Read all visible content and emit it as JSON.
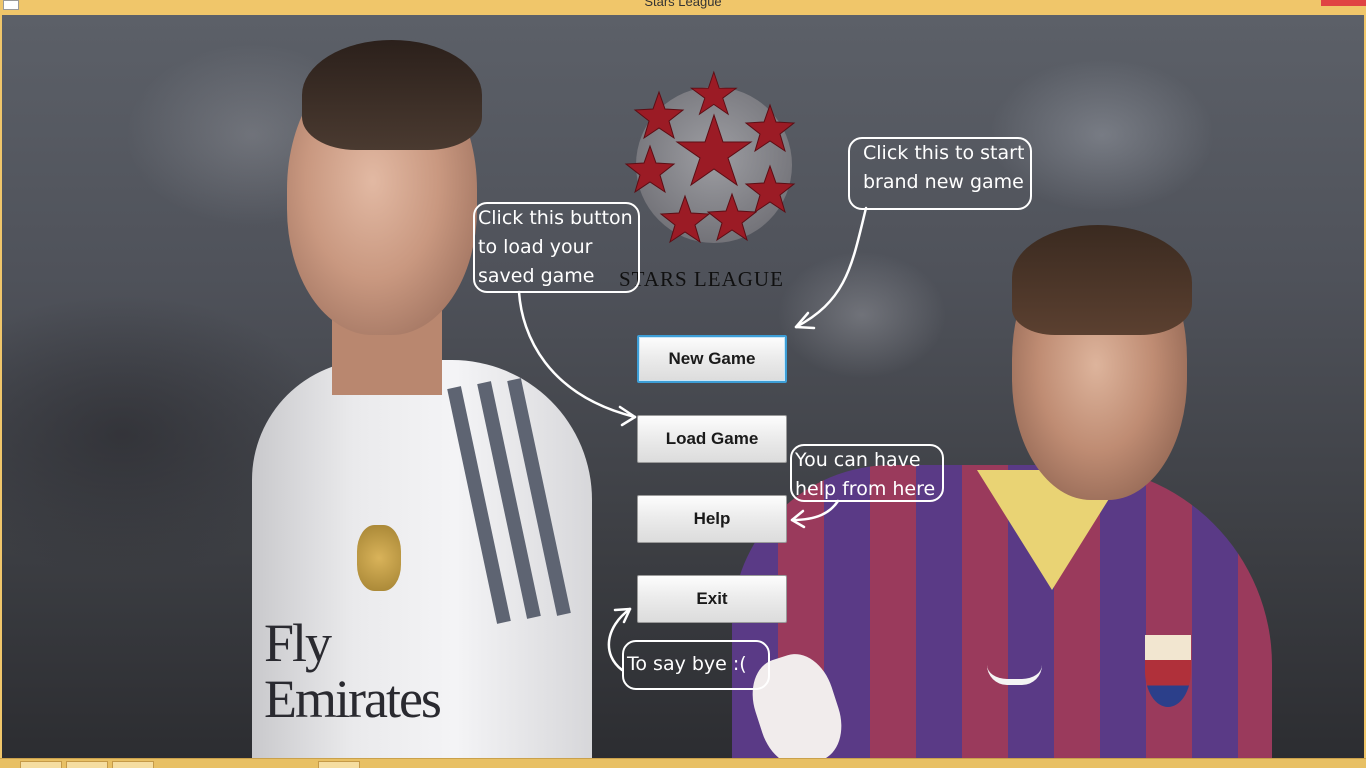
{
  "window": {
    "title": "Stars League"
  },
  "logo": {
    "text": "STARS LEAGUE",
    "star_color": "#9b1b25"
  },
  "menu": {
    "new_game": "New Game",
    "load_game": "Load Game",
    "help": "Help",
    "exit": "Exit"
  },
  "annotations": {
    "new_game": [
      "Click this to start",
      "brand new game"
    ],
    "load_game": [
      "Click this button",
      "to load your",
      "saved game"
    ],
    "help": [
      "You can have",
      "help from here"
    ],
    "exit": [
      "To say bye :("
    ]
  },
  "background": {
    "player_left_sponsor": "Fly\nEmirates"
  },
  "colors": {
    "frame": "#f0c66a",
    "focus_border": "#3d9ed6",
    "annotation": "#ffffff"
  }
}
